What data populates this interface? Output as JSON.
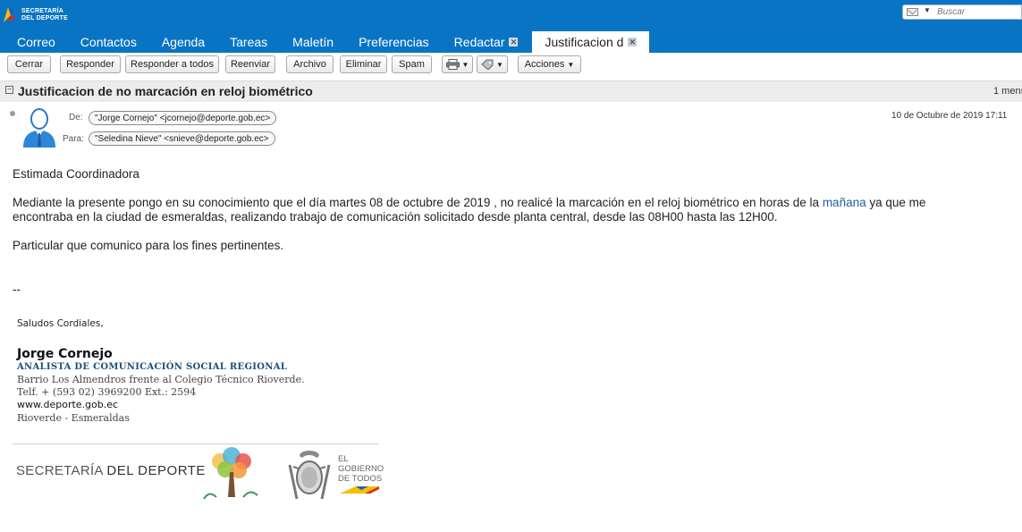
{
  "app": {
    "logo_line1": "SECRETARÍA",
    "logo_line2": "DEL DEPORTE",
    "search_placeholder": "Buscar",
    "colors": {
      "header": "#0a74c4",
      "accent_link": "#1e5f9e",
      "subject_bar": "#ececec"
    }
  },
  "nav": {
    "tabs": [
      {
        "label": "Correo"
      },
      {
        "label": "Contactos"
      },
      {
        "label": "Agenda"
      },
      {
        "label": "Tareas"
      },
      {
        "label": "Maletín"
      },
      {
        "label": "Preferencias"
      },
      {
        "label": "Redactar",
        "closable": true
      },
      {
        "label": "Justificacion d",
        "closable": true,
        "active": true
      }
    ],
    "close_glyph": "✕"
  },
  "toolbar": {
    "cerrar": "Cerrar",
    "responder": "Responder",
    "responder_todos": "Responder a todos",
    "reenviar": "Reenviar",
    "archivo": "Archivo",
    "eliminar": "Eliminar",
    "spam": "Spam",
    "acciones": "Acciones",
    "print_icon": "printer-icon",
    "tag_icon": "tag-icon"
  },
  "message": {
    "subject": "Justificacion de no marcación en reloj biométrico",
    "count_label": "1 mens",
    "from_label": "De:",
    "from": "\"Jorge Cornejo\" <jcornejo@deporte.gob.ec>",
    "to_label": "Para:",
    "to": "\"Seledina Nieve\" <snieve@deporte.gob.ec>",
    "date": "10 de Octubre de 2019 17:11"
  },
  "body": {
    "greeting": "Estimada Coordinadora",
    "p1_a": "Mediante la presente pongo en su conocimiento que el día martes 08 de octubre de 2019 , no realicé la marcación en el reloj biométrico en horas de la ",
    "p1_link": "mañana",
    "p1_b": " ya que me",
    "p2": "encontraba en la ciudad de esmeraldas, realizando trabajo de comunicación  solicitado desde planta central, desde las 08H00 hasta las 12H00.",
    "p3": "Particular que comunico para los fines pertinentes.",
    "dashes": "--"
  },
  "signature": {
    "greeting": "Saludos Cordiales,",
    "name": "Jorge Cornejo",
    "title": "ANALISTA DE COMUNICACIÓN SOCIAL REGIONAL",
    "address": "Barrio Los Almendros frente al Colegio Técnico Rioverde.",
    "phone": "Telf. + (593 02) 3969200 Ext.: 2594",
    "web": "www.deporte.gob.ec",
    "city": "Rioverde - Esmeraldas",
    "footer_logo_a": "SECRETARÍA",
    "footer_logo_b": "DEL DEPORTE",
    "gob_1": "EL",
    "gob_2": "GOBIERNO",
    "gob_3": "DE TODOS"
  }
}
